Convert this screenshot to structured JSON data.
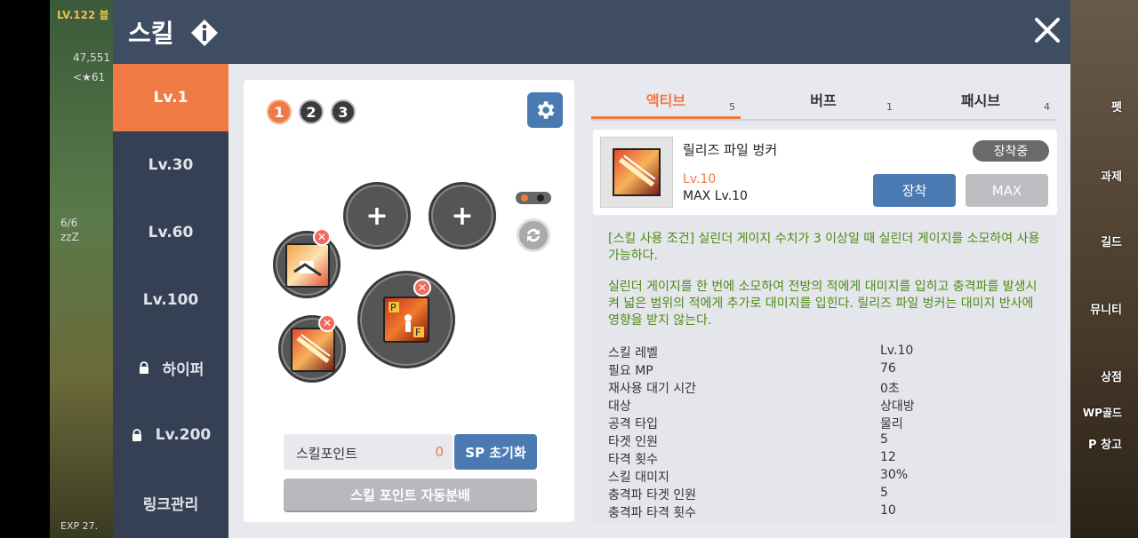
{
  "background": {
    "level": "LV.122 블",
    "power": "47,551",
    "location": "<★61",
    "count": "6/6",
    "zzz": "zzZ",
    "exp": "EXP 27.",
    "right_labels": [
      "펫",
      "과제",
      "길드",
      "뮤니티",
      "상점",
      "WP골드",
      "P 창고"
    ]
  },
  "header": {
    "title": "스킬"
  },
  "sidebar": {
    "items": [
      {
        "label": "Lv.1",
        "active": true,
        "locked": false
      },
      {
        "label": "Lv.30",
        "active": false,
        "locked": false
      },
      {
        "label": "Lv.60",
        "active": false,
        "locked": false
      },
      {
        "label": "Lv.100",
        "active": false,
        "locked": false
      },
      {
        "label": "하이퍼",
        "active": false,
        "locked": true
      },
      {
        "label": "Lv.200",
        "active": false,
        "locked": true
      },
      {
        "label": "링크관리",
        "active": false,
        "locked": false
      }
    ]
  },
  "presets": [
    "1",
    "2",
    "3"
  ],
  "skill_points": {
    "label": "스킬포인트",
    "value": "0",
    "reset_label": "SP 초기화",
    "auto_label": "스킬 포인트 자동분배"
  },
  "tabs": [
    {
      "label": "액티브",
      "count": "5",
      "active": true
    },
    {
      "label": "버프",
      "count": "1",
      "active": false
    },
    {
      "label": "패시브",
      "count": "4",
      "active": false
    }
  ],
  "skill": {
    "name": "릴리즈 파일 벙커",
    "level": "Lv.10",
    "max_level": "MAX Lv.10",
    "status": "장착중",
    "equip_label": "장착",
    "max_label": "MAX",
    "condition": "[스킬 사용 조건] 실린더 게이지 수치가 3 이상일 때 실린더 게이지를 소모하여 사용 가능하다.",
    "effect": "실린더 게이지를 한 번에 소모하여 전방의 적에게 대미지를 입히고 충격파를 발생시켜 넓은 범위의 적에게 추가로 대미지를 입힌다. 릴리즈 파일 벙커는 대미지 반사에 영향을 받지 않는다.",
    "stats": [
      {
        "k": "스킬 레벨",
        "v": "Lv.10"
      },
      {
        "k": "필요 MP",
        "v": "76"
      },
      {
        "k": "재사용 대기 시간",
        "v": "0초"
      },
      {
        "k": "대상",
        "v": "상대방"
      },
      {
        "k": "공격 타입",
        "v": "물리"
      },
      {
        "k": "타겟 인원",
        "v": "5"
      },
      {
        "k": "타격 횟수",
        "v": "12"
      },
      {
        "k": "스킬 대미지",
        "v": "30%"
      },
      {
        "k": "충격파 타겟 인원",
        "v": "5"
      },
      {
        "k": "충격파 타격 횟수",
        "v": "10"
      }
    ]
  },
  "colors": {
    "accent": "#ef7a43",
    "blue": "#4b7ab3",
    "header": "#3f4d63",
    "sidebar": "#354055",
    "green_text": "#4d8b16"
  }
}
